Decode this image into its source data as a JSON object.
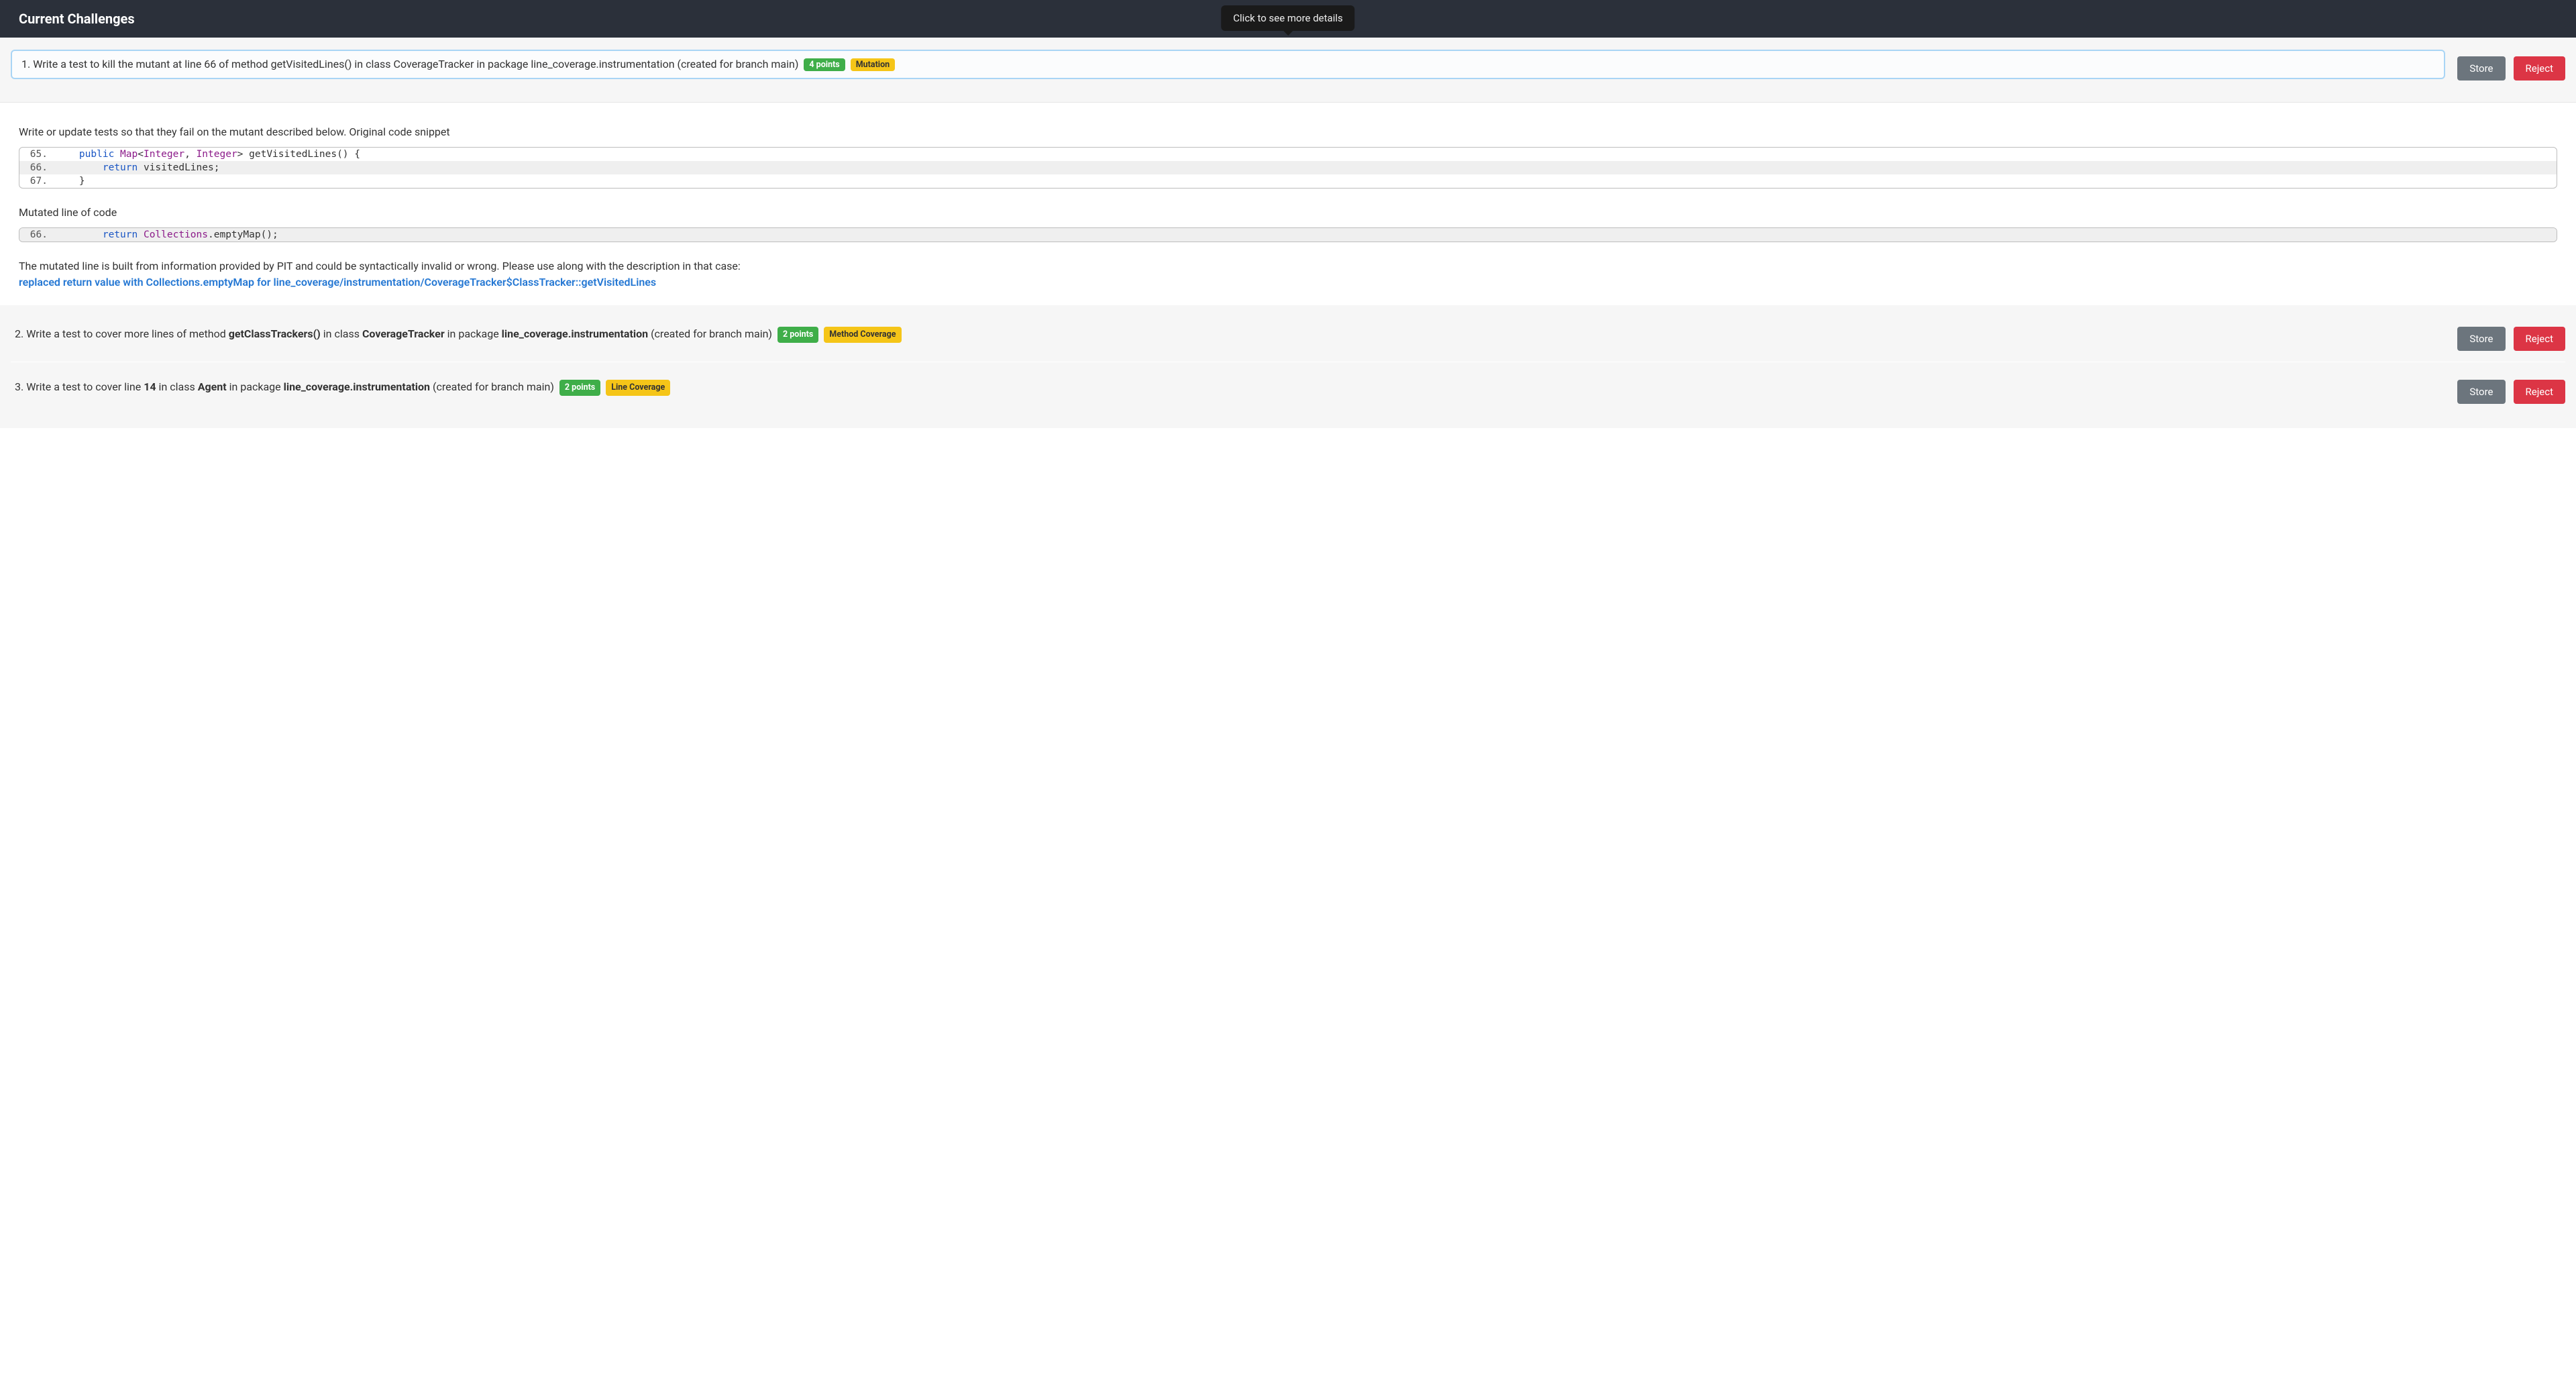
{
  "header": {
    "title": "Current Challenges"
  },
  "tooltip": {
    "text": "Click to see more details"
  },
  "buttons": {
    "store": "Store",
    "reject": "Reject"
  },
  "challenges": [
    {
      "num": "1.",
      "pre1": " Write a test to kill the mutant at line ",
      "lineNum": "66",
      "pre2": " of method ",
      "method": "getVisitedLines()",
      "pre3": " in class ",
      "class": "CoverageTracker",
      "pre4": " in package ",
      "package": "line_coverage.instrumentation",
      "suffix": " (created for branch main)",
      "pointsBadge": "4 points",
      "typeBadge": "Mutation",
      "badgeClass": "badge-mutation",
      "highlighted": true
    },
    {
      "num": "2.",
      "pre1": " Write a test to cover more lines of method ",
      "method": "getClassTrackers()",
      "pre3": " in class ",
      "class": "CoverageTracker",
      "pre4": " in package ",
      "package": "line_coverage.instrumentation",
      "suffix": " (created for branch main)",
      "pointsBadge": "2 points",
      "typeBadge": "Method Coverage",
      "badgeClass": "badge-method"
    },
    {
      "num": "3.",
      "pre1": " Write a test to cover line ",
      "lineNum": "14",
      "pre3": " in class ",
      "class": "Agent",
      "pre4": " in package ",
      "package": "line_coverage.instrumentation",
      "suffix": " (created for branch main)",
      "pointsBadge": "2 points",
      "typeBadge": "Line Coverage",
      "badgeClass": "badge-line"
    }
  ],
  "details": {
    "intro": "Write or update tests so that they fail on the mutant described below. Original code snippet",
    "originalCode": [
      {
        "n": "65.",
        "hl": false,
        "tokens": [
          {
            "t": "    "
          },
          {
            "t": "public",
            "c": "tok-kw"
          },
          {
            "t": " "
          },
          {
            "t": "Map",
            "c": "tok-type"
          },
          {
            "t": "<"
          },
          {
            "t": "Integer",
            "c": "tok-type"
          },
          {
            "t": ", "
          },
          {
            "t": "Integer",
            "c": "tok-type"
          },
          {
            "t": "> getVisitedLines() {"
          }
        ]
      },
      {
        "n": "66.",
        "hl": true,
        "tokens": [
          {
            "t": "        "
          },
          {
            "t": "return",
            "c": "tok-kw"
          },
          {
            "t": " visitedLines;"
          }
        ]
      },
      {
        "n": "67.",
        "hl": false,
        "tokens": [
          {
            "t": "    }"
          }
        ]
      }
    ],
    "mutatedLabel": "Mutated line of code",
    "mutatedCode": [
      {
        "n": "66.",
        "hl": true,
        "tokens": [
          {
            "t": "        "
          },
          {
            "t": "return",
            "c": "tok-kw"
          },
          {
            "t": " "
          },
          {
            "t": "Collections",
            "c": "tok-type"
          },
          {
            "t": ".emptyMap();"
          }
        ]
      }
    ],
    "pitNote": "The mutated line is built from information provided by PIT and could be syntactically invalid or wrong. Please use along with the description in that case:",
    "pitLink": "replaced return value with Collections.emptyMap for line_coverage/instrumentation/CoverageTracker$ClassTracker::getVisitedLines"
  }
}
